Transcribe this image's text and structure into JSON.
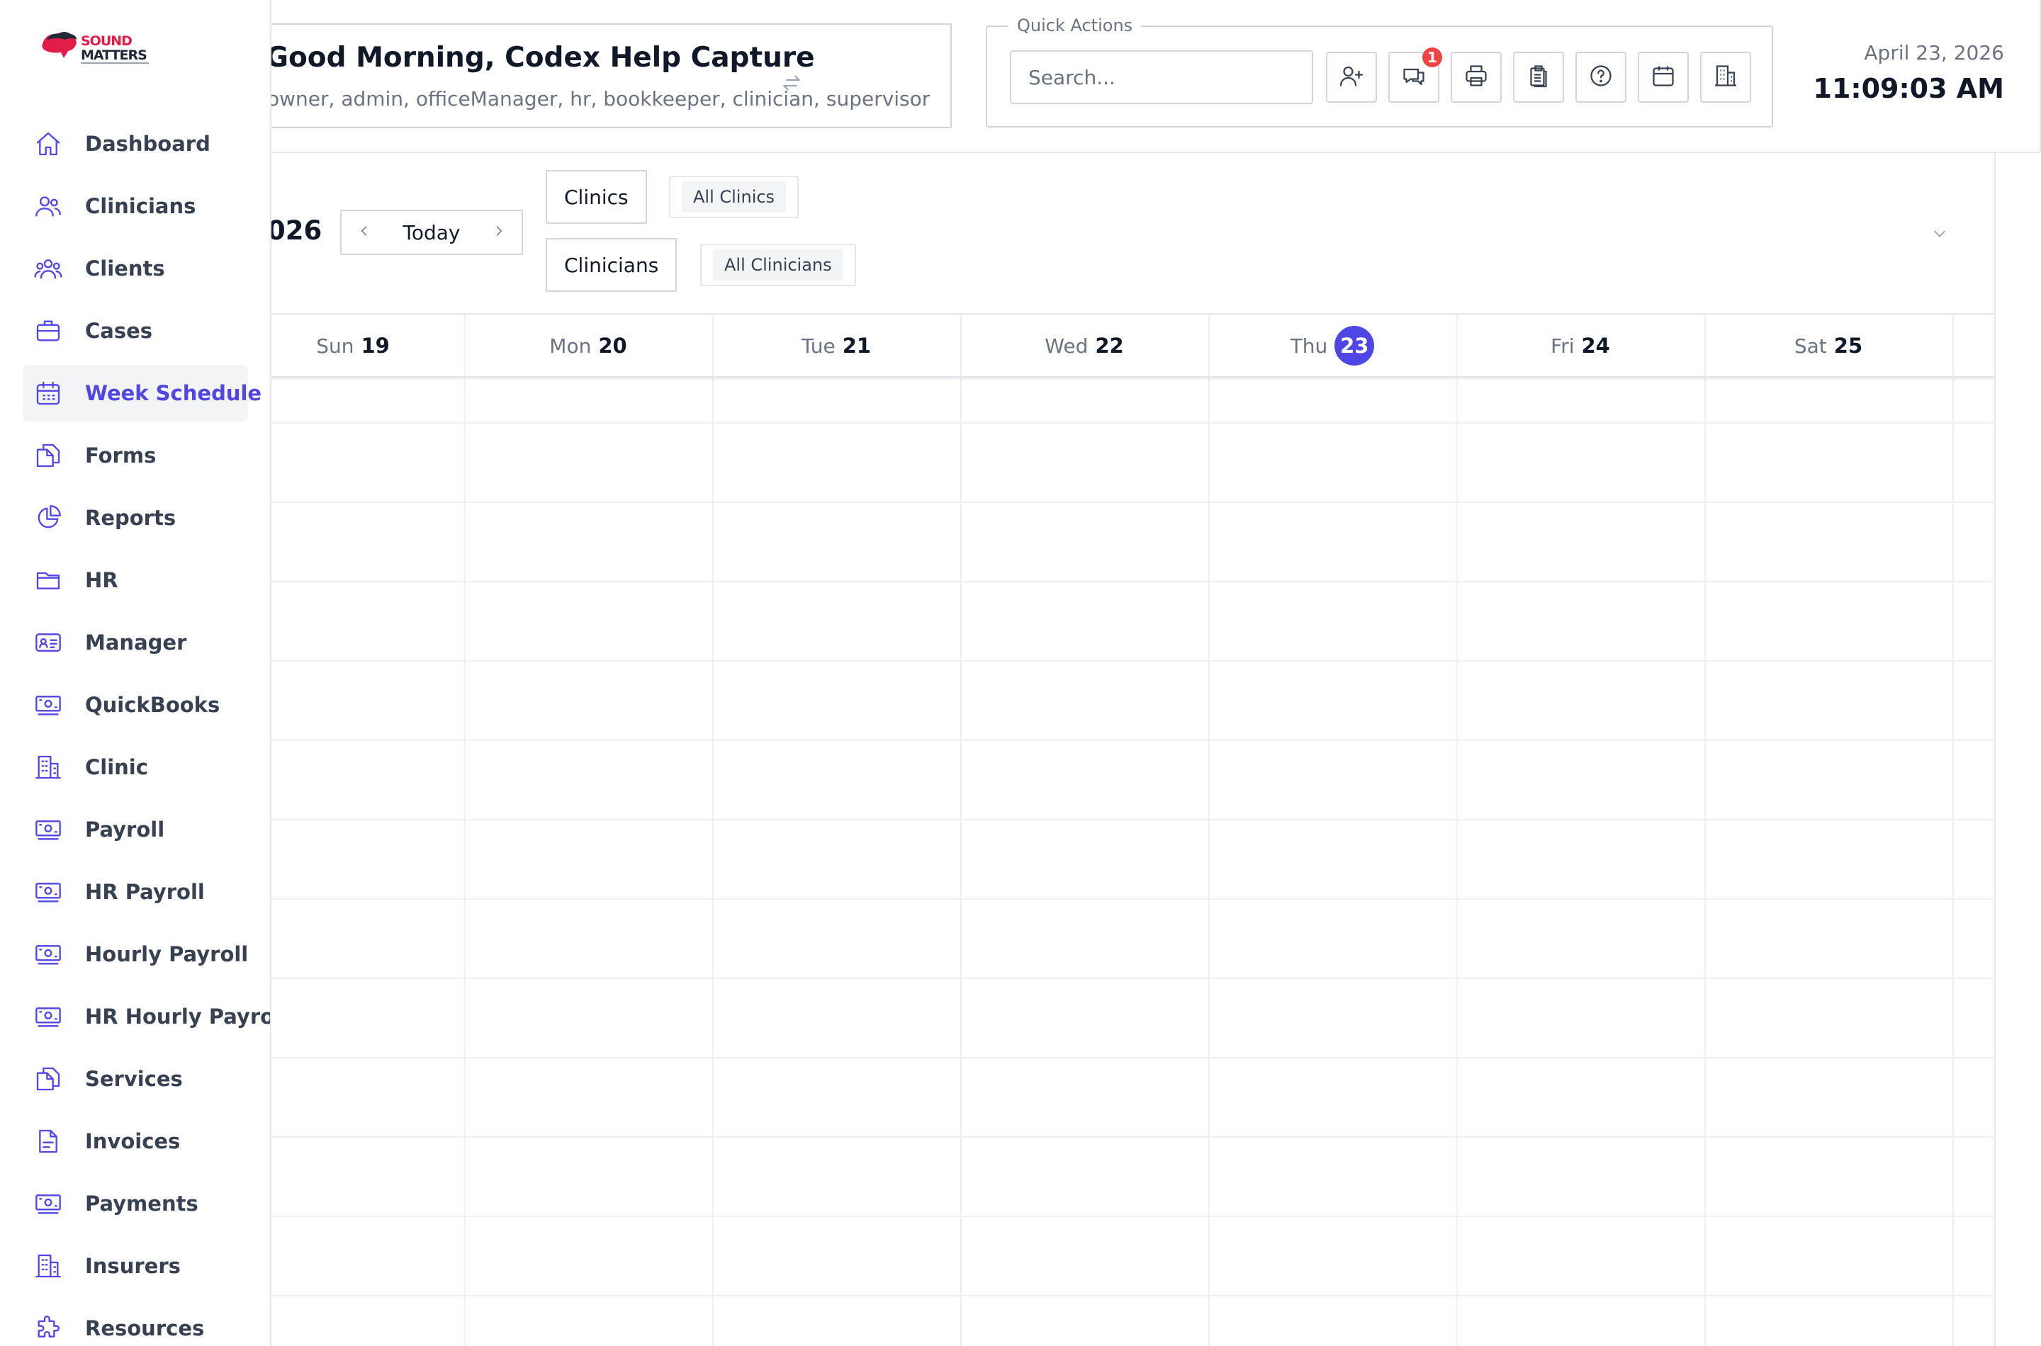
{
  "brand": {
    "logo_text": "SOUND MATTERS",
    "accent_color": "#4f46e5",
    "logo_color": "#e11d48"
  },
  "sidebar": {
    "items": [
      {
        "label": "Dashboard",
        "icon": "home-icon",
        "active": false
      },
      {
        "label": "Clinicians",
        "icon": "users-icon",
        "active": false
      },
      {
        "label": "Clients",
        "icon": "user-group-icon",
        "active": false
      },
      {
        "label": "Cases",
        "icon": "briefcase-icon",
        "active": false
      },
      {
        "label": "Week Schedule",
        "icon": "calendar-days-icon",
        "active": true
      },
      {
        "label": "Forms",
        "icon": "documents-icon",
        "active": false
      },
      {
        "label": "Reports",
        "icon": "chart-pie-icon",
        "active": false
      },
      {
        "label": "HR",
        "icon": "folder-icon",
        "active": false
      },
      {
        "label": "Manager",
        "icon": "id-card-icon",
        "active": false
      },
      {
        "label": "QuickBooks",
        "icon": "banknotes-icon",
        "active": false
      },
      {
        "label": "Clinic",
        "icon": "building-icon",
        "active": false
      },
      {
        "label": "Payroll",
        "icon": "banknotes-icon",
        "active": false
      },
      {
        "label": "HR Payroll",
        "icon": "banknotes-icon",
        "active": false
      },
      {
        "label": "Hourly Payroll",
        "icon": "banknotes-icon",
        "active": false
      },
      {
        "label": "HR Hourly Payroll",
        "icon": "banknotes-icon",
        "active": false
      },
      {
        "label": "Services",
        "icon": "documents-icon",
        "active": false
      },
      {
        "label": "Invoices",
        "icon": "document-text-icon",
        "active": false
      },
      {
        "label": "Payments",
        "icon": "banknotes-icon",
        "active": false
      },
      {
        "label": "Insurers",
        "icon": "building-icon",
        "active": false
      },
      {
        "label": "Resources",
        "icon": "puzzle-icon",
        "active": false
      }
    ]
  },
  "header": {
    "greeting": "Good Morning, Codex Help Capture",
    "roles": "owner, admin, officeManager, hr, bookkeeper, clinician, supervisor",
    "quick_actions": {
      "legend": "Quick Actions",
      "search_placeholder": "Search...",
      "buttons": [
        "add-user-icon",
        "chat-icon",
        "printer-icon",
        "clipboard-icon",
        "help-icon",
        "calendar-icon",
        "building-icon"
      ],
      "message_badge": "1"
    },
    "date": "April 23, 2026",
    "time": "11:09:03 AM"
  },
  "toolbar": {
    "month_label": "026",
    "today_label": "Today",
    "clinics_label": "Clinics",
    "clinics_value": "All Clinics",
    "clinicians_label": "Clinicians",
    "clinicians_value": "All Clinicians"
  },
  "week": {
    "days": [
      {
        "name": "Sun",
        "num": "19",
        "today": false
      },
      {
        "name": "Mon",
        "num": "20",
        "today": false
      },
      {
        "name": "Tue",
        "num": "21",
        "today": false
      },
      {
        "name": "Wed",
        "num": "22",
        "today": false
      },
      {
        "name": "Thu",
        "num": "23",
        "today": true
      },
      {
        "name": "Fri",
        "num": "24",
        "today": false
      },
      {
        "name": "Sat",
        "num": "25",
        "today": false
      }
    ]
  }
}
